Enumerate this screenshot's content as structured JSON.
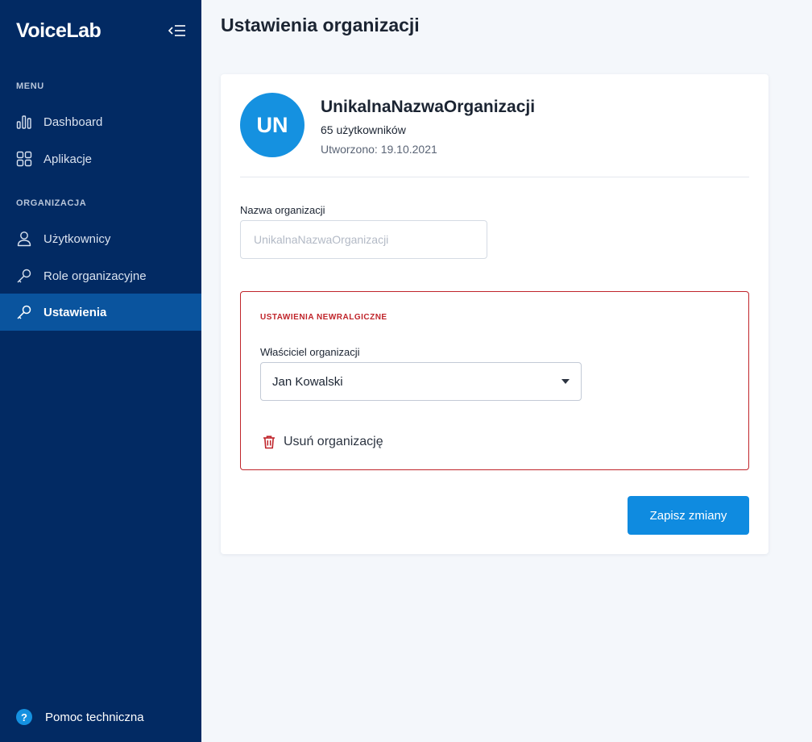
{
  "app": {
    "logo_text": "VoiceLab",
    "brand_color": "#022a63",
    "accent_color": "#1591e0",
    "danger_color": "#c0252b"
  },
  "sidebar": {
    "collapse_icon": "collapse-menu-icon",
    "sections": {
      "menu_label": "MENU",
      "organization_label": "ORGANIZACJA"
    },
    "items": [
      {
        "label": "Dashboard",
        "icon": "bar-chart-icon",
        "active": false
      },
      {
        "label": "Aplikacje",
        "icon": "grid-icon",
        "active": false
      },
      {
        "label": "Użytkownicy",
        "icon": "user-icon",
        "active": false
      },
      {
        "label": "Role organizacyjne",
        "icon": "key-icon",
        "active": false
      },
      {
        "label": "Ustawienia",
        "icon": "key-icon",
        "active": true
      }
    ],
    "help": {
      "label": "Pomoc techniczna",
      "icon_glyph": "?"
    }
  },
  "page": {
    "title": "Ustawienia organizacji"
  },
  "org": {
    "initials": "UN",
    "name": "UnikalnaNazwaOrganizacji",
    "users": "65 użytkowników",
    "created": "Utworzono: 19.10.2021"
  },
  "form": {
    "name_label": "Nazwa organizacji",
    "name_value": "",
    "name_placeholder": "UnikalnaNazwaOrganizacji"
  },
  "danger": {
    "title": "USTAWIENIA NEWRALGICZNE",
    "owner_label": "Właściciel organizacji",
    "owner_selected": "Jan Kowalski",
    "delete_label": "Usuń organizację"
  },
  "actions": {
    "save_label": "Zapisz zmiany"
  }
}
